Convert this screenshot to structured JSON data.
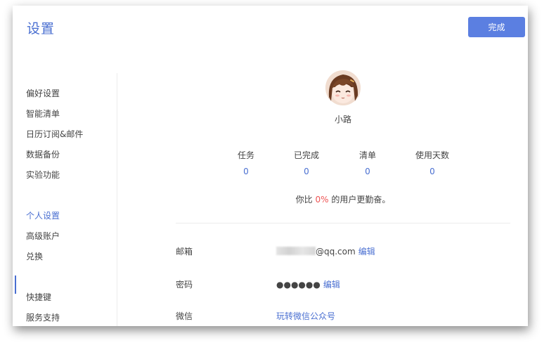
{
  "header": {
    "title": "设置",
    "done_label": "完成"
  },
  "sidebar": {
    "items": [
      {
        "label": "偏好设置"
      },
      {
        "label": "智能清单"
      },
      {
        "label": "日历订阅&邮件"
      },
      {
        "label": "数据备份"
      },
      {
        "label": "实验功能"
      },
      {
        "label": "个人设置"
      },
      {
        "label": "高级账户"
      },
      {
        "label": "兑换"
      },
      {
        "label": "快捷键"
      },
      {
        "label": "服务支持"
      }
    ],
    "active": "个人设置"
  },
  "profile": {
    "avatar_icon": "anime-girl-avatar-icon",
    "username": "小路"
  },
  "stats": [
    {
      "label": "任务",
      "value": "0"
    },
    {
      "label": "已完成",
      "value": "0"
    },
    {
      "label": "清单",
      "value": "0"
    },
    {
      "label": "使用天数",
      "value": "0"
    }
  ],
  "compare": {
    "prefix": "你比",
    "percent": "0%",
    "suffix": "的用户更勤奋。"
  },
  "account": {
    "email_label": "邮箱",
    "email_value": "@qq.com",
    "email_edit": "编辑",
    "password_label": "密码",
    "password_value": "●●●●●●",
    "password_edit": "编辑",
    "wechat_label": "微信",
    "wechat_link": "玩转微信公众号"
  },
  "colors": {
    "accent": "#4a6fd1",
    "button": "#5b7fe1",
    "highlight": "#ee5454"
  }
}
